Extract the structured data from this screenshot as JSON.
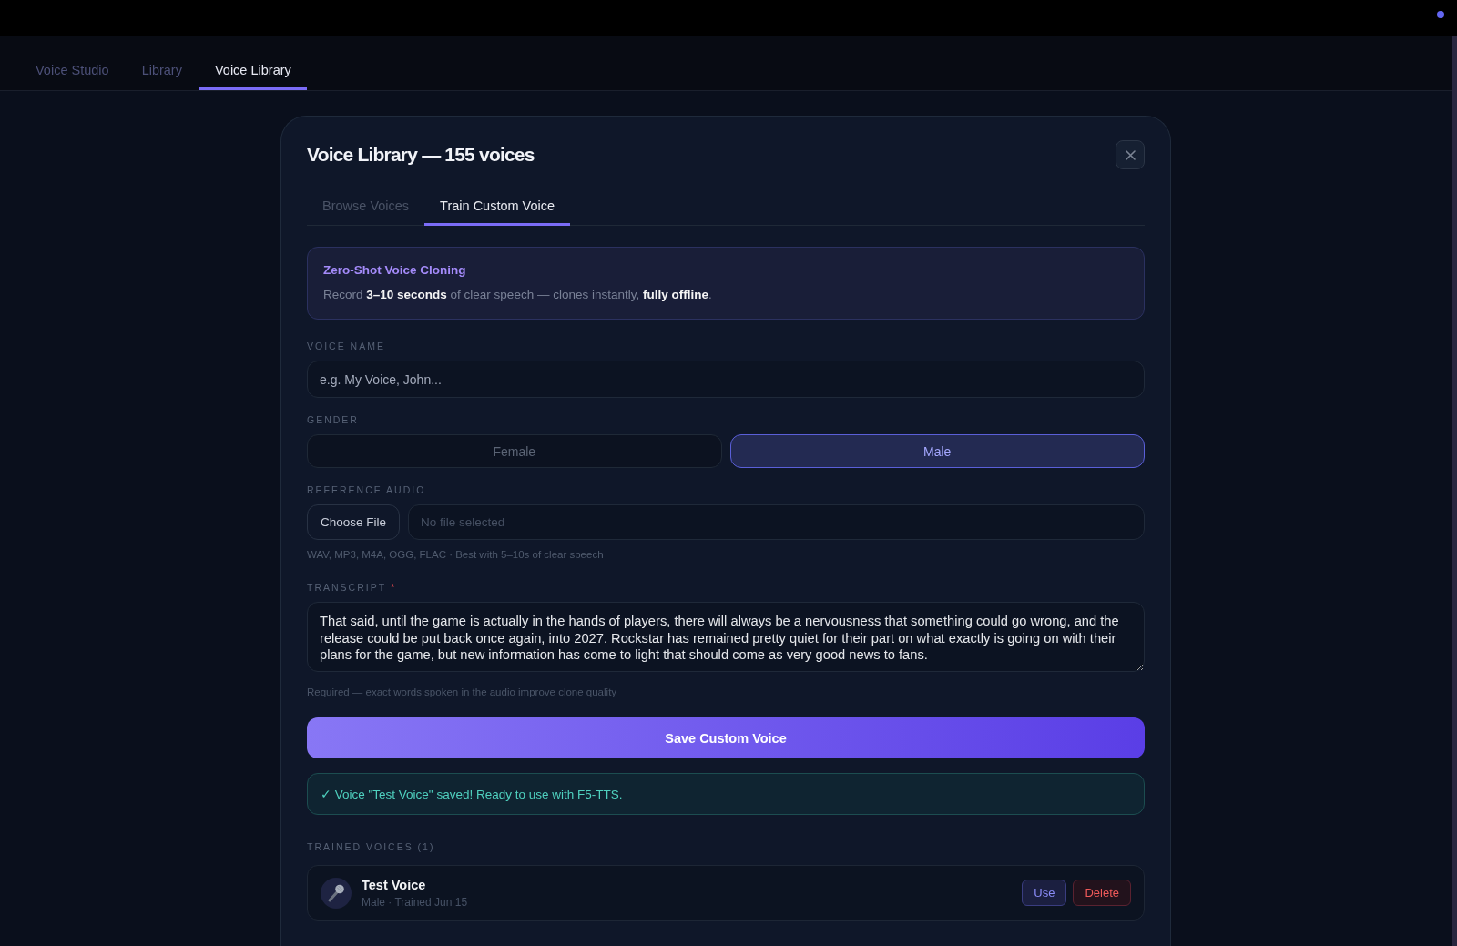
{
  "nav_tabs": [
    {
      "label": "Voice Studio",
      "selected": false
    },
    {
      "label": "Library",
      "selected": false
    },
    {
      "label": "Voice Library",
      "selected": true
    }
  ],
  "modal": {
    "title": "Voice Library — 155 voices",
    "tabs": [
      {
        "label": "Browse Voices",
        "selected": false
      },
      {
        "label": "Train Custom Voice",
        "selected": true
      }
    ],
    "info": {
      "title": "Zero-Shot Voice Cloning",
      "text": "Record **3–10 seconds** of clear speech — clones instantly, **fully offline**."
    },
    "voice_name": {
      "label": "VOICE NAME",
      "placeholder": "e.g. My Voice, John..."
    },
    "gender": {
      "label": "GENDER",
      "options": [
        {
          "label": "Female",
          "selected": false
        },
        {
          "label": "Male",
          "selected": true
        }
      ]
    },
    "reference_audio": {
      "label": "REFERENCE AUDIO",
      "button": "Choose File",
      "file_name": "No file selected",
      "hint": "WAV, MP3, M4A, OGG, FLAC · Best with 5–10s of clear speech"
    },
    "transcript": {
      "label": "TRANSCRIPT",
      "required_mark": "*",
      "value": "That said, until the game is actually in the hands of players, there will always be a nervousness that something could go wrong, and the release could be put back once again, into 2027. Rockstar has remained pretty quiet for their part on what exactly is going on with their plans for the game, but new information has come to light that should come as very good news to fans.",
      "hint": "Required — exact words spoken in the audio improve clone quality"
    },
    "save_button": "Save Custom Voice",
    "success_message": "✓ Voice \"Test Voice\" saved! Ready to use with F5-TTS.",
    "trained_voices": {
      "label": "TRAINED VOICES (1)",
      "items": [
        {
          "name": "Test Voice",
          "meta": "Male · Trained Jun 15",
          "actions": [
            {
              "label": "Use",
              "kind": "use"
            },
            {
              "label": "Delete",
              "kind": "delete"
            }
          ]
        }
      ]
    }
  }
}
